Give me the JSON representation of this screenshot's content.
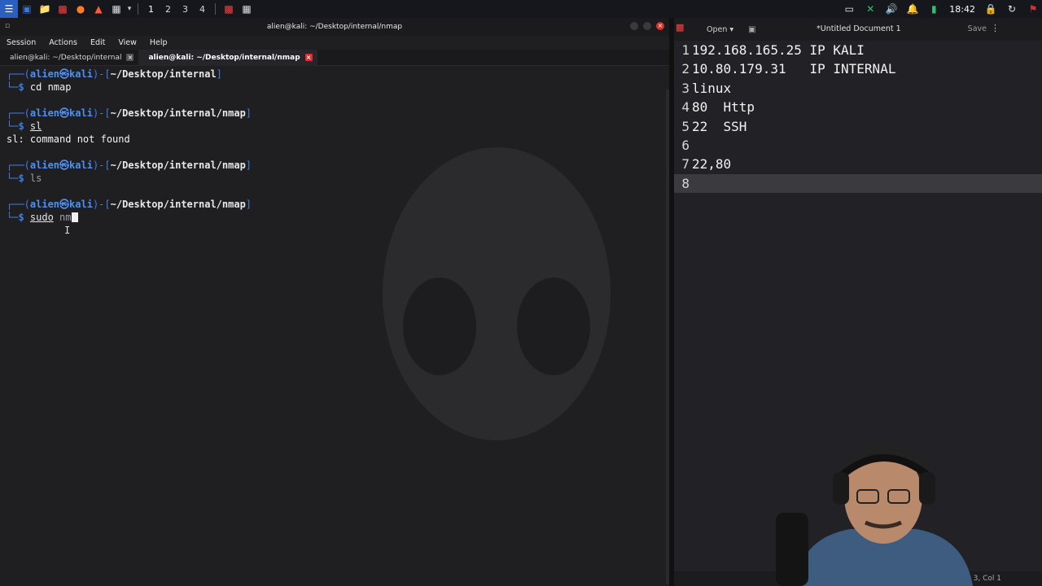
{
  "panel": {
    "workspaces": [
      "1",
      "2",
      "3",
      "4"
    ],
    "clock": "18:42"
  },
  "terminal": {
    "title": "alien@kali: ~/Desktop/internal/nmap",
    "menu": [
      "Session",
      "Actions",
      "Edit",
      "View",
      "Help"
    ],
    "tabs": [
      {
        "label": "alien@kali: ~/Desktop/internal"
      },
      {
        "label": "alien@kali: ~/Desktop/internal/nmap"
      }
    ],
    "prompt_user": "alien㉿kali",
    "blocks": [
      {
        "path": "~/Desktop/internal",
        "command": "cd nmap",
        "output": ""
      },
      {
        "path": "~/Desktop/internal/nmap",
        "command": "sl",
        "output": "sl: command not found"
      },
      {
        "path": "~/Desktop/internal/nmap",
        "command": "ls",
        "output": ""
      },
      {
        "path": "~/Desktop/internal/nmap",
        "command_main": "sudo",
        "command_rest": "nm",
        "output": ""
      }
    ]
  },
  "editor": {
    "open_label": "Open",
    "title": "*Untitled Document 1",
    "save_label": "Save",
    "lines": [
      "192.168.165.25 IP KALI",
      "10.80.179.31   IP INTERNAL",
      "linux",
      "80  Http",
      "22  SSH",
      "",
      "22,80",
      ""
    ],
    "line_numbers": [
      "1",
      "2",
      "3",
      "4",
      "5",
      "6",
      "7",
      "8"
    ],
    "status": "3, Col 1"
  },
  "colors": {
    "prompt_blue": "#3f7ee0",
    "user_blue": "#4f8ff0",
    "close_red": "#d9302c"
  }
}
